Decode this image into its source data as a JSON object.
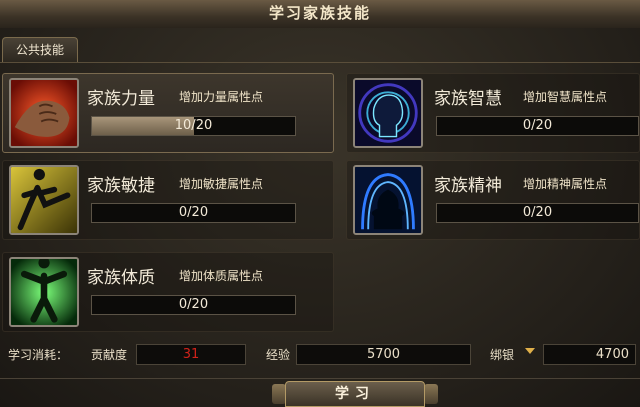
{
  "window": {
    "title": "学习家族技能"
  },
  "tabs": [
    {
      "label": "公共技能"
    }
  ],
  "skills": [
    {
      "name": "家族力量",
      "desc": "增加力量属性点",
      "progress_text": "10/20",
      "progress": 0.5,
      "icon": "fist-icon"
    },
    {
      "name": "家族智慧",
      "desc": "增加智慧属性点",
      "progress_text": "0/20",
      "progress": 0,
      "icon": "head-brain-icon"
    },
    {
      "name": "家族敏捷",
      "desc": "增加敏捷属性点",
      "progress_text": "0/20",
      "progress": 0,
      "icon": "kick-figure-icon"
    },
    {
      "name": "家族精神",
      "desc": "增加精神属性点",
      "progress_text": "0/20",
      "progress": 0,
      "icon": "spirit-silhouette-icon"
    },
    {
      "name": "家族体质",
      "desc": "增加体质属性点",
      "progress_text": "0/20",
      "progress": 0,
      "icon": "body-aura-icon"
    }
  ],
  "cost": {
    "label": "学习消耗：",
    "contribution_label": "贡献度",
    "contribution_value": "31",
    "exp_label": "经验",
    "exp_value": "5700",
    "silver_label": "绑银",
    "silver_value": "4700"
  },
  "learn_button": {
    "label": "学习"
  },
  "colors": {
    "contribution_value": "#d0221a",
    "accent_gold": "#b39a66"
  }
}
